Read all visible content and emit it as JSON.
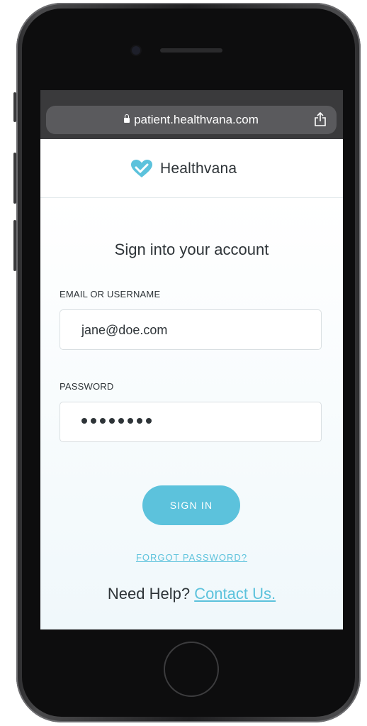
{
  "browser": {
    "url": "patient.healthvana.com"
  },
  "header": {
    "brand_name": "Healthvana"
  },
  "form": {
    "title": "Sign into your account",
    "email_label": "EMAIL OR USERNAME",
    "email_value": "jane@doe.com",
    "password_label": "PASSWORD",
    "password_mask_length": 8,
    "signin_label": "SIGN IN",
    "forgot_label": "FORGOT PASSWORD?"
  },
  "help": {
    "prefix": "Need Help?",
    "link": "Contact Us."
  },
  "colors": {
    "accent": "#5cc2dc",
    "text": "#2e3438",
    "browser_chrome": "#3a3a3c"
  }
}
